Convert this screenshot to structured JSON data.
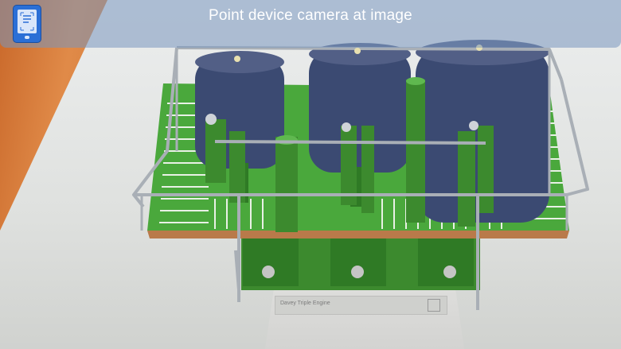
{
  "banner": {
    "text": "Point device camera at image"
  },
  "device_button": {
    "icon": "phone-scan-icon",
    "color": "#2b6fd6"
  },
  "model": {
    "name": "Davey Triple Engine"
  },
  "colors": {
    "frame_green": "#2f8a2a",
    "cylinder_navy": "#3a4a70",
    "rail_grey": "#a9afb6"
  }
}
